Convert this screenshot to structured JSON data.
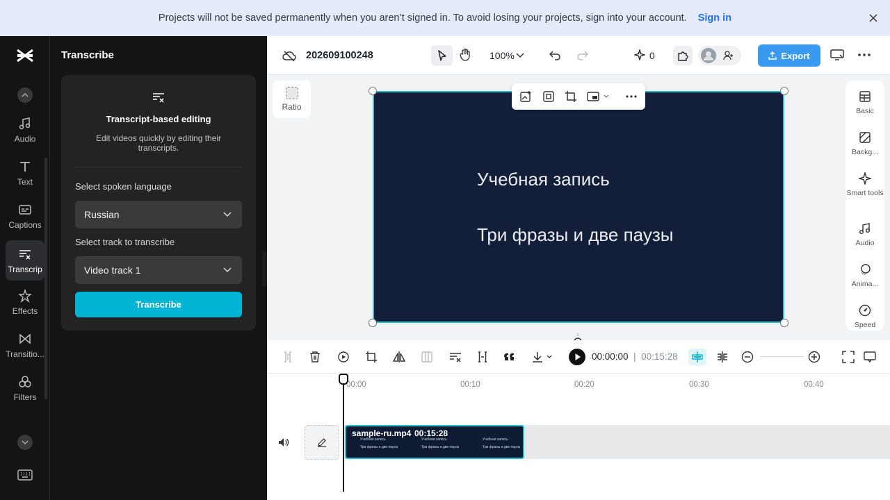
{
  "banner": {
    "message": "Projects will not be saved permanently when you aren’t signed in. To avoid losing your projects, sign into your account.",
    "signin": "Sign in"
  },
  "rail": {
    "items": [
      {
        "label": "Audio",
        "icon": "music-note-icon"
      },
      {
        "label": "Text",
        "icon": "text-icon"
      },
      {
        "label": "Captions",
        "icon": "captions-icon"
      },
      {
        "label": "Transcrip",
        "icon": "transcript-icon"
      },
      {
        "label": "Effects",
        "icon": "effects-icon"
      },
      {
        "label": "Transitio...",
        "icon": "transition-icon"
      },
      {
        "label": "Filters",
        "icon": "filters-icon"
      }
    ]
  },
  "panel": {
    "title": "Transcribe",
    "card_title": "Transcript-based editing",
    "card_desc": "Edit videos quickly by editing their transcripts.",
    "language_label": "Select spoken language",
    "language_value": "Russian",
    "track_label": "Select track to transcribe",
    "track_value": "Video track 1",
    "transcribe_button": "Transcribe"
  },
  "topbar": {
    "project_name": "202609100248",
    "zoom": "100%",
    "credits": "0",
    "export": "Export"
  },
  "stage": {
    "ratio_label": "Ratio",
    "line1": "Учебная запись",
    "line2": "Три фразы и две паузы"
  },
  "right_panel": [
    {
      "label": "Basic",
      "icon": "basic-icon"
    },
    {
      "label": "Backg...",
      "icon": "background-icon"
    },
    {
      "label": "Smart tools",
      "icon": "smart-tools-icon"
    },
    {
      "label": "Audio",
      "icon": "music-note-icon"
    },
    {
      "label": "Anima...",
      "icon": "animation-icon"
    },
    {
      "label": "Speed",
      "icon": "speed-icon"
    }
  ],
  "timeline": {
    "current_time": "00:00:00",
    "total_time": "00:15:28",
    "ticks": [
      "00:00",
      "00:10",
      "00:20",
      "00:30",
      "00:40"
    ],
    "clip_name": "sample-ru.mp4",
    "clip_duration": "00:15:28",
    "mini_line1": "Учебная запись",
    "mini_line2": "Три фразы и две паузы"
  }
}
